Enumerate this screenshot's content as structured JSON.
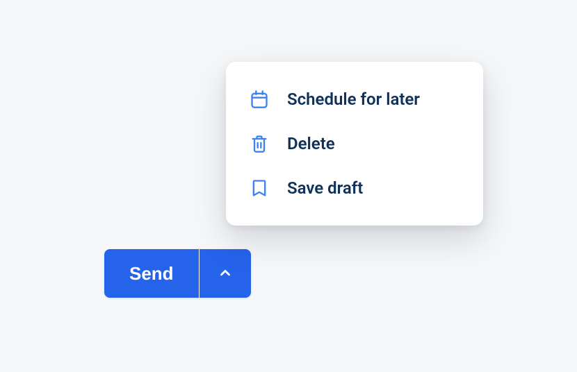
{
  "button": {
    "send_label": "Send"
  },
  "menu": {
    "items": [
      {
        "label": "Schedule for later",
        "icon": "calendar-icon"
      },
      {
        "label": "Delete",
        "icon": "trash-icon"
      },
      {
        "label": "Save draft",
        "icon": "bookmark-icon"
      }
    ]
  }
}
